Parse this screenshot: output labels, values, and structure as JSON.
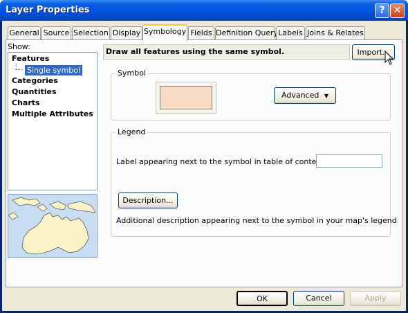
{
  "window": {
    "title": "Layer Properties",
    "help_symbol": "?",
    "close_symbol": "✕"
  },
  "tabs": [
    {
      "label": "General"
    },
    {
      "label": "Source"
    },
    {
      "label": "Selection"
    },
    {
      "label": "Display"
    },
    {
      "label": "Symbology"
    },
    {
      "label": "Fields"
    },
    {
      "label": "Definition Query"
    },
    {
      "label": "Labels"
    },
    {
      "label": "Joins & Relates"
    }
  ],
  "active_tab": "Symbology",
  "show": {
    "label": "Show:",
    "items": [
      {
        "label": "Features"
      },
      {
        "label": "Single symbol",
        "selected": true
      },
      {
        "label": "Categories"
      },
      {
        "label": "Quantities"
      },
      {
        "label": "Charts"
      },
      {
        "label": "Multiple Attributes"
      }
    ]
  },
  "symbology": {
    "description": "Draw all features using the same symbol.",
    "import_label": "Import...",
    "symbol_group": "Symbol",
    "symbol_fill_color": "#f8dbc6",
    "advanced_label": "Advanced",
    "legend_group": "Legend",
    "label_prompt": "Label appearing next to the symbol in table of contents:",
    "label_value": "",
    "description_button": "Description...",
    "description_note": "Additional description appearing next to the symbol in your map's legend"
  },
  "buttons": {
    "ok": "OK",
    "cancel": "Cancel",
    "apply": "Apply"
  },
  "colors": {
    "title_bar": "#0054e3",
    "selection": "#316ac5",
    "dialog_bg": "#ece9d8"
  }
}
